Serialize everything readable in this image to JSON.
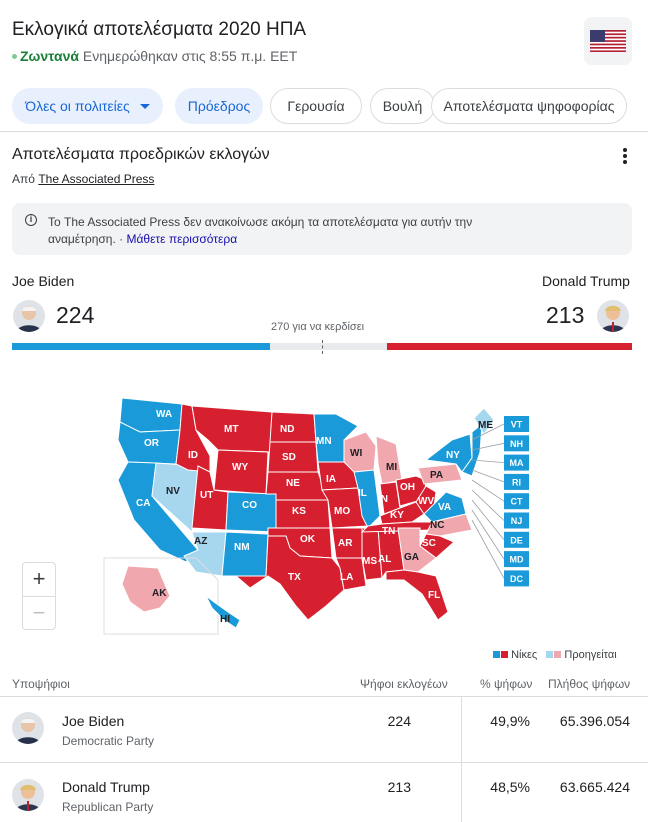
{
  "header": {
    "title": "Εκλογικά αποτελέσματα 2020 ΗΠΑ",
    "live_label": "Ζωντανά",
    "updated": "Ενημερώθηκαν στις 8:55 π.μ. EET",
    "flag_icon": "us-flag-icon"
  },
  "chips": [
    {
      "label": "Όλες οι πολιτείες",
      "selected": true
    },
    {
      "label": "Πρόεδρος",
      "selected": true
    },
    {
      "label": "Γερουσία",
      "selected": false
    },
    {
      "label": "Βουλή",
      "selected": false
    },
    {
      "label": "Αποτελέσματα ψηφοφορίας",
      "selected": false
    }
  ],
  "section": {
    "title": "Αποτελέσματα προεδρικών εκλογών",
    "source_prefix": "Από",
    "source_link": "The Associated Press"
  },
  "notice": {
    "text": "Το The Associated Press δεν ανακοίνωσε ακόμη τα αποτελέσματα για αυτήν την αναμέτρηση.",
    "more": "Μάθετε περισσότερα"
  },
  "race": {
    "dem": {
      "name": "Joe Biden",
      "electoral_votes": "224"
    },
    "rep": {
      "name": "Donald Trump",
      "electoral_votes": "213"
    },
    "to_win": "270 για να κερδίσει",
    "total_electoral": 538,
    "dem_share": 0.4164,
    "rep_share": 0.3959
  },
  "colors": {
    "dem_win": "#1a9ad8",
    "dem_lead": "#a6d7ee",
    "rep_win": "#d7202f",
    "rep_lead": "#f1a7ae"
  },
  "map": {
    "states": [
      "WA",
      "OR",
      "CA",
      "NV",
      "ID",
      "MT",
      "WY",
      "UT",
      "AZ",
      "CO",
      "NM",
      "ND",
      "SD",
      "NE",
      "KS",
      "OK",
      "TX",
      "MN",
      "IA",
      "MO",
      "AR",
      "LA",
      "WI",
      "IL",
      "MS",
      "AL",
      "MI",
      "IN",
      "KY",
      "TN",
      "OH",
      "WV",
      "VA",
      "PA",
      "NY",
      "ME",
      "NC",
      "SC",
      "GA",
      "FL",
      "AK",
      "HI"
    ],
    "small_states": [
      "VT",
      "NH",
      "MA",
      "RI",
      "CT",
      "NJ",
      "DE",
      "MD",
      "DC"
    ],
    "zoom_in": "+",
    "zoom_out": "−"
  },
  "legend": {
    "wins": "Νίκες",
    "leading": "Προηγείται"
  },
  "table": {
    "headers": [
      "Υποψήφιοι",
      "Ψήφοι εκλογέων",
      "% ψήφων",
      "Πλήθος ψήφων"
    ],
    "rows": [
      {
        "name": "Joe Biden",
        "party": "Democratic Party",
        "electoral": "224",
        "pct": "49,9%",
        "votes": "65.396.054"
      },
      {
        "name": "Donald Trump",
        "party": "Republican Party",
        "electoral": "213",
        "pct": "48,5%",
        "votes": "63.665.424"
      }
    ]
  }
}
